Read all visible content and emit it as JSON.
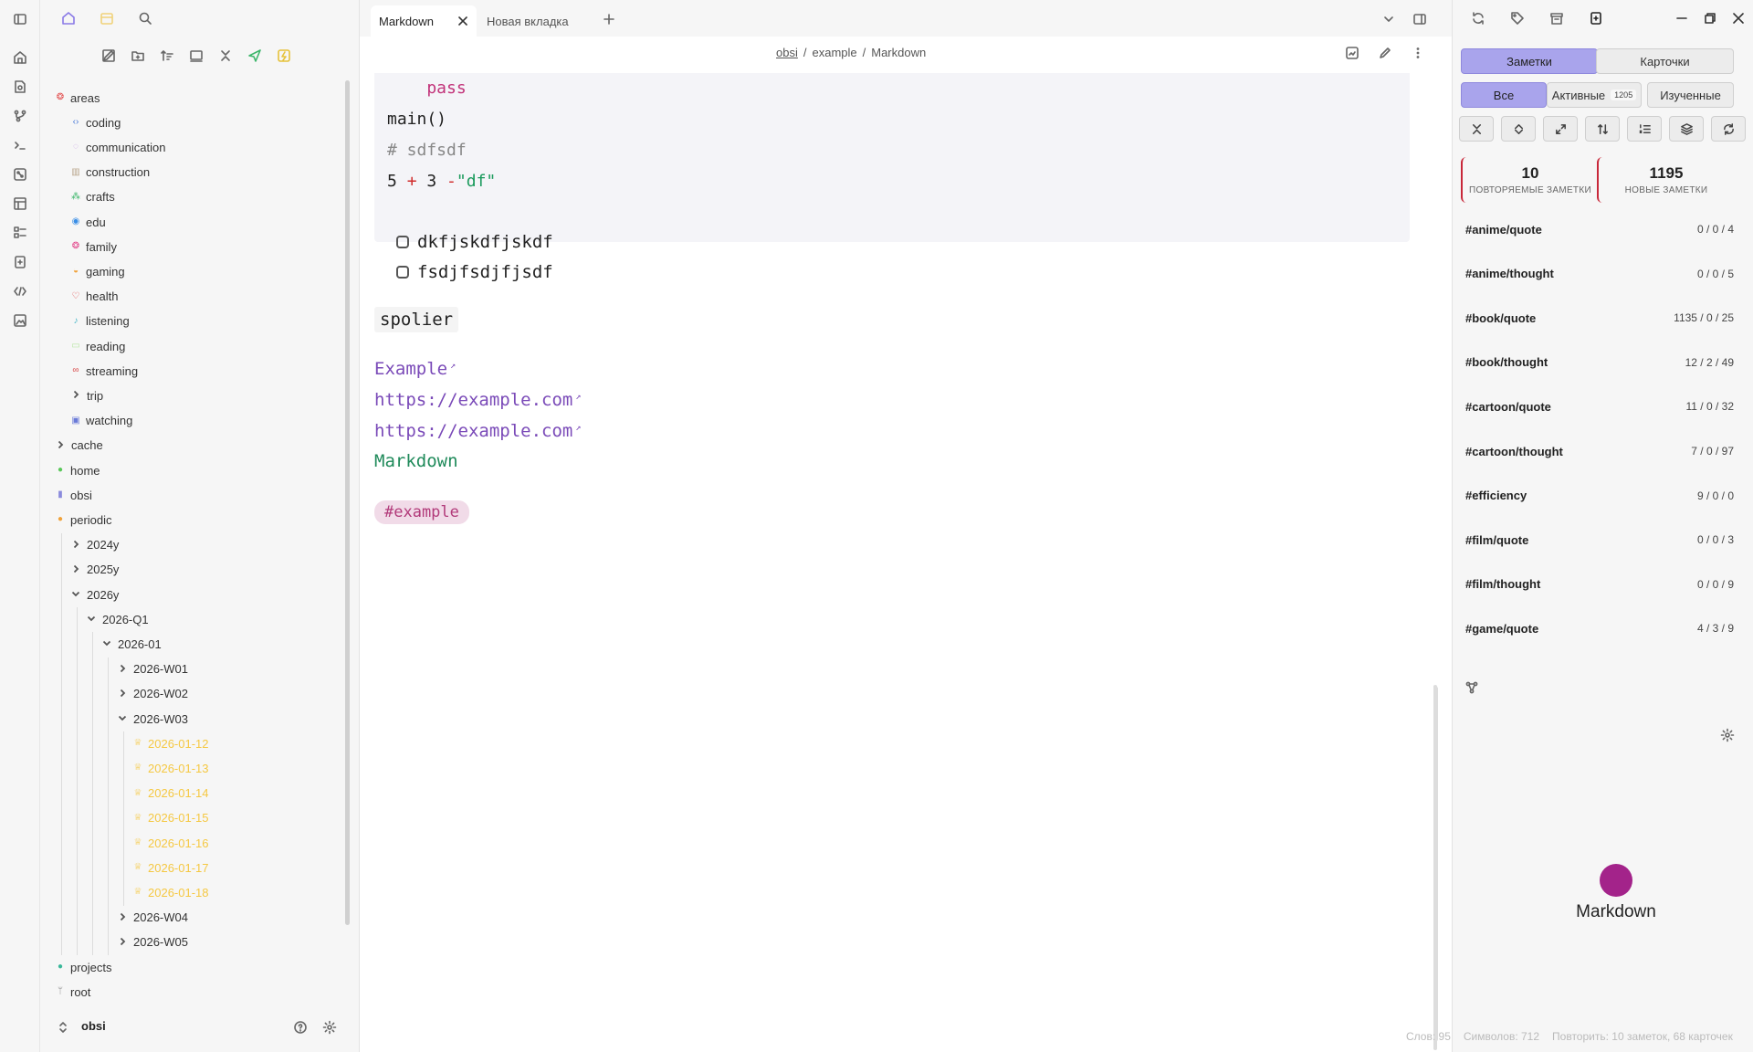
{
  "tabs": [
    {
      "label": "Markdown",
      "active": true
    },
    {
      "label": "Новая вкладка",
      "active": false
    }
  ],
  "breadcrumb": [
    "obsi",
    "example",
    "Markdown"
  ],
  "code_lines": [
    {
      "parts": [
        {
          "t": "    pass",
          "c": "kw"
        }
      ]
    },
    {
      "parts": [
        {
          "t": "main()",
          "c": ""
        }
      ]
    },
    {
      "parts": [
        {
          "t": "# sdfsdf",
          "c": "cm"
        }
      ]
    },
    {
      "parts": [
        {
          "t": "5 ",
          "c": ""
        },
        {
          "t": "+",
          "c": "op"
        },
        {
          "t": " 3 ",
          "c": ""
        },
        {
          "t": "-",
          "c": "op"
        },
        {
          "t": "\"df\"",
          "c": "str"
        }
      ]
    }
  ],
  "tasks": [
    "dkfjskdfjskdf",
    "fsdjfsdjfjsdf"
  ],
  "spoiler": "spolier",
  "links": [
    "Example",
    "https://example.com",
    "https://example.com"
  ],
  "internal_link": "Markdown",
  "tag": "#example",
  "tree": [
    {
      "label": "areas",
      "depth": 0,
      "icon": "areas",
      "color": "#e24d4d"
    },
    {
      "label": "coding",
      "depth": 1,
      "icon": "code",
      "color": "#4a7bd8"
    },
    {
      "label": "communication",
      "depth": 1,
      "icon": "chat",
      "color": "#c8a4e6"
    },
    {
      "label": "construction",
      "depth": 1,
      "icon": "build",
      "color": "#b8a48a"
    },
    {
      "label": "crafts",
      "depth": 1,
      "icon": "craft",
      "color": "#3cb66a"
    },
    {
      "label": "edu",
      "depth": 1,
      "icon": "edu",
      "color": "#3a8ee6"
    },
    {
      "label": "family",
      "depth": 1,
      "icon": "family",
      "color": "#e2458a"
    },
    {
      "label": "gaming",
      "depth": 1,
      "icon": "game",
      "color": "#f0a23a"
    },
    {
      "label": "health",
      "depth": 1,
      "icon": "heart",
      "color": "#e24d4d"
    },
    {
      "label": "listening",
      "depth": 1,
      "icon": "music",
      "color": "#4ab8c8"
    },
    {
      "label": "reading",
      "depth": 1,
      "icon": "book",
      "color": "#b8e6a4"
    },
    {
      "label": "streaming",
      "depth": 1,
      "icon": "stream",
      "color": "#d84a4a"
    },
    {
      "label": "trip",
      "depth": 1,
      "chev": "right"
    },
    {
      "label": "watching",
      "depth": 1,
      "icon": "watch",
      "color": "#6a7ad8"
    },
    {
      "label": "cache",
      "depth": 0,
      "chev": "right"
    },
    {
      "label": "home",
      "depth": 0,
      "icon": "dot",
      "color": "#5ac85a"
    },
    {
      "label": "obsi",
      "depth": 0,
      "icon": "obsi",
      "color": "#8a8adc"
    },
    {
      "label": "periodic",
      "depth": 0,
      "icon": "dot",
      "color": "#f0a23a"
    },
    {
      "label": "2024y",
      "depth": 1,
      "chev": "right"
    },
    {
      "label": "2025y",
      "depth": 1,
      "chev": "right"
    },
    {
      "label": "2026y",
      "depth": 1,
      "chev": "down"
    },
    {
      "label": "2026-Q1",
      "depth": 2,
      "chev": "down"
    },
    {
      "label": "2026-01",
      "depth": 3,
      "chev": "down"
    },
    {
      "label": "2026-W01",
      "depth": 4,
      "chev": "right"
    },
    {
      "label": "2026-W02",
      "depth": 4,
      "chev": "right"
    },
    {
      "label": "2026-W03",
      "depth": 4,
      "chev": "down"
    },
    {
      "label": "2026-01-12",
      "depth": 5,
      "icon": "trophy",
      "dim": true
    },
    {
      "label": "2026-01-13",
      "depth": 5,
      "icon": "trophy",
      "dim": true
    },
    {
      "label": "2026-01-14",
      "depth": 5,
      "icon": "trophy",
      "dim": true
    },
    {
      "label": "2026-01-15",
      "depth": 5,
      "icon": "trophy",
      "dim": true
    },
    {
      "label": "2026-01-16",
      "depth": 5,
      "icon": "trophy",
      "dim": true
    },
    {
      "label": "2026-01-17",
      "depth": 5,
      "icon": "trophy",
      "dim": true
    },
    {
      "label": "2026-01-18",
      "depth": 5,
      "icon": "trophy",
      "dim": true
    },
    {
      "label": "2026-W04",
      "depth": 4,
      "chev": "right"
    },
    {
      "label": "2026-W05",
      "depth": 4,
      "chev": "right"
    },
    {
      "label": "projects",
      "depth": 0,
      "icon": "dot",
      "color": "#3ab89a"
    },
    {
      "label": "root",
      "depth": 0,
      "icon": "branch",
      "color": "#888"
    }
  ],
  "vault_name": "obsi",
  "flashcards": {
    "mode_tabs": [
      "Заметки",
      "Карточки"
    ],
    "filter_tabs": [
      {
        "label": "Все"
      },
      {
        "label": "Активные",
        "count": "1205"
      },
      {
        "label": "Изученные"
      }
    ],
    "stats": [
      {
        "value": "10",
        "label": "ПОВТОРЯЕМЫЕ ЗАМЕТКИ"
      },
      {
        "value": "1195",
        "label": "НОВЫЕ ЗАМЕТКИ"
      }
    ],
    "decks": [
      {
        "name": "#anime/quote",
        "counts": "0 / 0 / 4"
      },
      {
        "name": "#anime/thought",
        "counts": "0 / 0 / 5"
      },
      {
        "name": "#book/quote",
        "counts": "1135 / 0 / 25"
      },
      {
        "name": "#book/thought",
        "counts": "12 / 2 / 49"
      },
      {
        "name": "#cartoon/quote",
        "counts": "11 / 0 / 32"
      },
      {
        "name": "#cartoon/thought",
        "counts": "7 / 0 / 97"
      },
      {
        "name": "#efficiency",
        "counts": "9 / 0 / 0"
      },
      {
        "name": "#film/quote",
        "counts": "0 / 0 / 3"
      },
      {
        "name": "#film/thought",
        "counts": "0 / 0 / 9"
      },
      {
        "name": "#game/quote",
        "counts": "4 / 3 / 9"
      }
    ]
  },
  "graph_node_label": "Markdown",
  "node_color": "#a3238a",
  "accent_color": "#a9a4ec",
  "status": {
    "words": "Слов: 95",
    "chars": "Символов: 712",
    "review": "Повторить: 10 заметок, 68 карточек"
  }
}
